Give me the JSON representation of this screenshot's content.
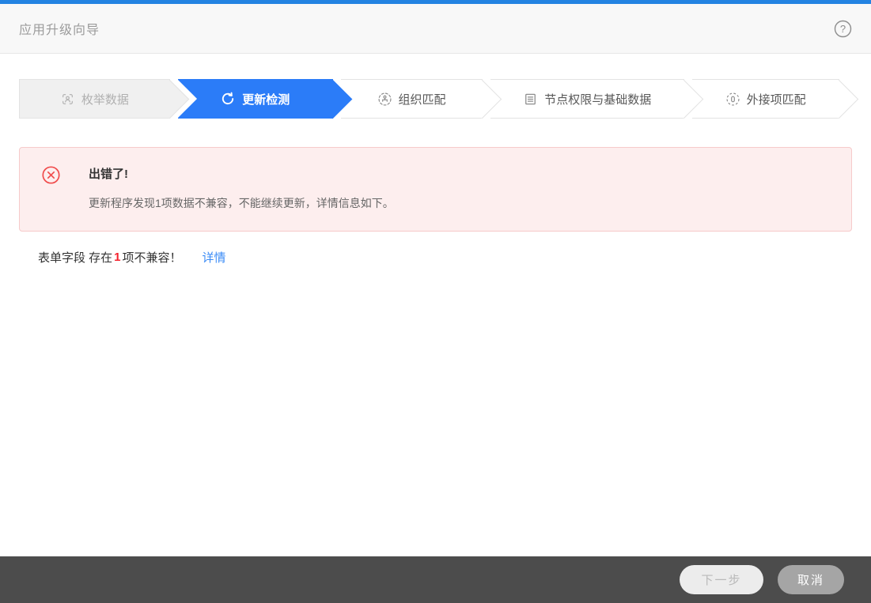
{
  "window": {
    "title": "应用升级向导",
    "help_icon": "help-circle-icon"
  },
  "steps": [
    {
      "label": "枚举数据",
      "icon": "enum-data-icon",
      "state": "done"
    },
    {
      "label": "更新检测",
      "icon": "refresh-icon",
      "state": "active"
    },
    {
      "label": "组织匹配",
      "icon": "org-match-icon",
      "state": "pending"
    },
    {
      "label": "节点权限与基础数据",
      "icon": "node-permission-icon",
      "state": "pending"
    },
    {
      "label": "外接项匹配",
      "icon": "external-item-icon",
      "state": "pending"
    }
  ],
  "alert": {
    "icon": "error-circle-icon",
    "title": "出错了!",
    "message": "更新程序发现1项数据不兼容，不能继续更新，详情信息如下。"
  },
  "result": {
    "prefix": "表单字段 存在",
    "count": "1",
    "suffix": "项不兼容！",
    "detail_link": "详情"
  },
  "footer": {
    "next_label": "下一步",
    "cancel_label": "取消"
  },
  "colors": {
    "accent_blue": "#2b7cf8",
    "top_strip_blue": "#2383e2",
    "error_red": "#f04b4b",
    "count_red": "#f5222d",
    "alert_bg": "#fdeeee",
    "link_blue": "#3a8bf6",
    "footer_bg": "#4c4c4c"
  }
}
